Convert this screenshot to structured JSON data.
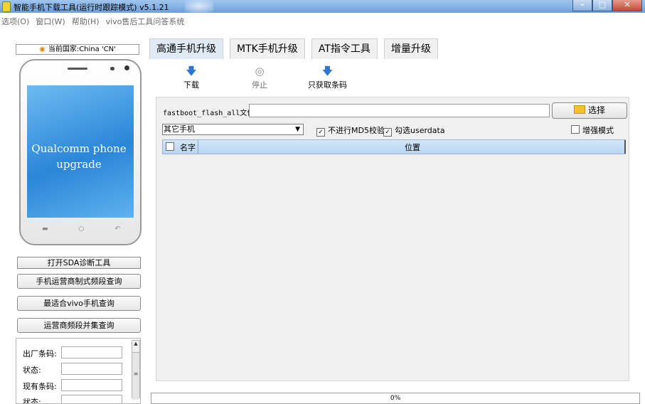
{
  "window": {
    "title": "智能手机下载工具(运行时跟踪模式) v5.1.21",
    "controls": {
      "minimize": "–",
      "maximize": "□",
      "close": "✕"
    }
  },
  "menubar": {
    "items": [
      "选项(O)",
      "窗口(W)",
      "帮助(H)",
      "vivo售后工具问答系统"
    ]
  },
  "sidebar": {
    "country_label": "当前国家:China 'CN'",
    "phone_caption_line1": "Qualcomm phone",
    "phone_caption_line2": "upgrade",
    "buttons": [
      "打开SDA诊断工具",
      "手机运营商制式频段查询",
      "最适合vivo手机查询",
      "运营商频段并集查询"
    ],
    "fields": [
      {
        "label": "出厂条码:",
        "value": ""
      },
      {
        "label": "状态:",
        "value": ""
      },
      {
        "label": "现有条码:",
        "value": ""
      },
      {
        "label": "状态:",
        "value": ""
      }
    ]
  },
  "tabs": [
    {
      "label": "高通手机升级",
      "active": true
    },
    {
      "label": "MTK手机升级",
      "active": false
    },
    {
      "label": "AT指令工具",
      "active": false
    },
    {
      "label": "增量升级",
      "active": false
    }
  ],
  "toolbar": {
    "download_label": "下载",
    "stop_label": "停止",
    "barcode_label": "只获取条码"
  },
  "main": {
    "flash_file_label": "fastboot_flash_all文件",
    "flash_file_value": "",
    "choose_button": "选择",
    "phone_type": "其它手机",
    "md5_check_label": "不进行MD5校验",
    "md5_checked": true,
    "userdata_label": "勾选userdata",
    "userdata_checked": true,
    "enhanced_label": "增强模式",
    "enhanced_checked": false,
    "table": {
      "columns": [
        "名字",
        "位置"
      ],
      "rows": []
    }
  },
  "progress": {
    "text": "0%",
    "value": 0
  },
  "colors": {
    "accent": "#2e78d0",
    "tab_active": "#dfeaf5",
    "table_header": "#b8d6f2"
  }
}
